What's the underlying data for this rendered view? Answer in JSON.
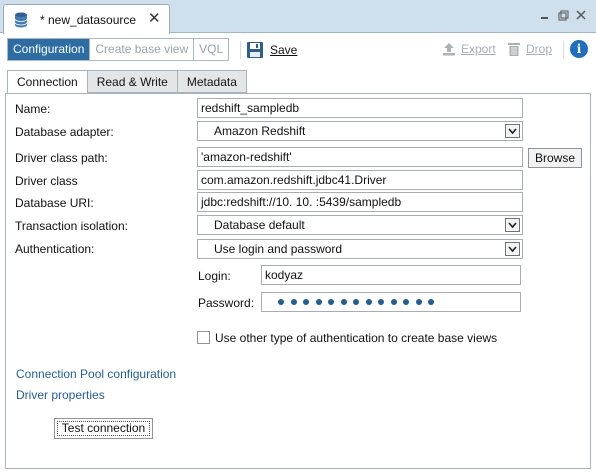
{
  "titlebar": {
    "doc_title": "* new_datasource",
    "icons": {
      "doc": "database-icon",
      "close": "close-icon",
      "minimize": "minimize-icon",
      "restore": "restore-icon",
      "close_view": "close-view-icon"
    }
  },
  "toolbar": {
    "mode_tabs": [
      "Configuration",
      "Create base view",
      "VQL"
    ],
    "active_mode": "Configuration",
    "save_label": "Save",
    "export_label": "Export",
    "drop_label": "Drop"
  },
  "subtabs": [
    "Connection",
    "Read & Write",
    "Metadata"
  ],
  "form": {
    "name_label": "Name:",
    "name_value": "redshift_sampledb",
    "adapter_label": "Database adapter:",
    "adapter_value": "Amazon Redshift",
    "driver_path_label": "Driver class path:",
    "driver_path_value": "'amazon-redshift'",
    "browse_label": "Browse",
    "driver_class_label": "Driver class",
    "driver_class_value": "com.amazon.redshift.jdbc41.Driver",
    "uri_label": "Database URI:",
    "uri_value": "jdbc:redshift://10.    10.    :5439/sampledb",
    "isolation_label": "Transaction isolation:",
    "isolation_value": "Database default",
    "auth_label": "Authentication:",
    "auth_value": "Use login and password",
    "login_label": "Login:",
    "login_value": "kodyaz",
    "password_label": "Password:",
    "password_dots": 13,
    "other_auth_label": "Use other type of authentication to create base views",
    "other_auth_checked": false
  },
  "links": {
    "pool": "Connection Pool configuration",
    "driver_props": "Driver properties"
  },
  "test_connection_label": "Test connection",
  "colors": {
    "accent": "#2c6da6",
    "link": "#1e5f9a",
    "titlebar": "#cfe0ec"
  }
}
